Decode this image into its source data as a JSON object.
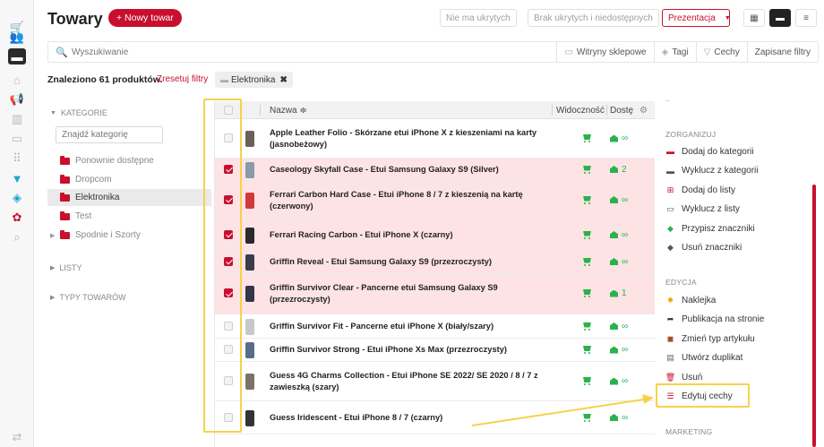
{
  "header": {
    "title": "Towary",
    "new_button": "+ Nowy towar",
    "filter_hidden": "Nie ma ukrytych",
    "filter_missing": "Brak ukrytych i niedostępnych",
    "presentation": "Prezentacja",
    "view_modes": [
      "grid-icon",
      "list-icon",
      "compact-list-icon"
    ]
  },
  "search": {
    "placeholder": "Wyszukiwanie",
    "filters": [
      {
        "label": "Witryny sklepowe",
        "icon": "storefront-icon"
      },
      {
        "label": "Tagi",
        "icon": "tag-icon"
      },
      {
        "label": "Cechy",
        "icon": "funnel-icon"
      },
      {
        "label": "Zapisane filtry",
        "icon": ""
      }
    ]
  },
  "results": {
    "found": "Znaleziono 61 produktów.",
    "reset": "Zresetuj filtry",
    "chip": "Elektronika"
  },
  "categories": {
    "header": "KATEGORIE",
    "search_placeholder": "Znajdź kategorię",
    "items": [
      {
        "label": "Ponownie dostępne",
        "selected": false,
        "expandable": false
      },
      {
        "label": "Dropcom",
        "selected": false,
        "expandable": false
      },
      {
        "label": "Elektronika",
        "selected": true,
        "expandable": false
      },
      {
        "label": "Test",
        "selected": false,
        "expandable": false
      },
      {
        "label": "Spodnie i Szorty",
        "selected": false,
        "expandable": true
      }
    ],
    "lists_header": "LISTY",
    "types_header": "TYPY TOWARÓW"
  },
  "table": {
    "col_name": "Nazwa ≑",
    "col_visibility": "Widoczność",
    "col_availability": "Dostę",
    "rows": [
      {
        "name": "Apple Leather Folio - Skórzane etui iPhone X z kieszeniami na karty (jasnobeżowy)",
        "checked": false,
        "stock": "∞",
        "thumb": "#6b6156"
      },
      {
        "name": "Caseology Skyfall Case - Etui Samsung Galaxy S9 (Silver)",
        "checked": true,
        "stock": "2",
        "thumb": "#8a9aa8"
      },
      {
        "name": "Ferrari Carbon Hard Case - Etui iPhone 8 / 7 z kieszenią na kartę (czerwony)",
        "checked": true,
        "stock": "∞",
        "thumb": "#d23a3a"
      },
      {
        "name": "Ferrari Racing Carbon - Etui iPhone X (czarny)",
        "checked": true,
        "stock": "∞",
        "thumb": "#2a2a2a"
      },
      {
        "name": "Griffin Reveal - Etui Samsung Galaxy S9 (przezroczysty)",
        "checked": true,
        "stock": "∞",
        "thumb": "#3b3b4a"
      },
      {
        "name": "Griffin Survivor Clear - Pancerne etui Samsung Galaxy S9 (przezroczysty)",
        "checked": true,
        "stock": "1",
        "thumb": "#34344a"
      },
      {
        "name": "Griffin Survivor Fit - Pancerne etui iPhone X (biały/szary)",
        "checked": false,
        "stock": "∞",
        "thumb": "#c8c8c8"
      },
      {
        "name": "Griffin Survivor Strong - Etui iPhone Xs Max (przezroczysty)",
        "checked": false,
        "stock": "∞",
        "thumb": "#5a6c8a"
      },
      {
        "name": "Guess 4G Charms Collection - Etui iPhone SE 2022/ SE 2020 / 8 / 7 z zawieszką (szary)",
        "checked": false,
        "stock": "∞",
        "thumb": "#7a7466"
      },
      {
        "name": "Guess Iridescent - Etui iPhone 8 / 7 (czarny)",
        "checked": false,
        "stock": "∞",
        "thumb": "#333"
      }
    ]
  },
  "actions": {
    "organize_header": "ZORGANIZUJ",
    "organize": [
      {
        "label": "Dodaj do kategorii",
        "icon": "folder-add-icon",
        "color": "#c8102e"
      },
      {
        "label": "Wyklucz z kategorii",
        "icon": "folder-remove-icon",
        "color": "#555"
      },
      {
        "label": "Dodaj do listy",
        "icon": "list-add-icon",
        "color": "#c8102e"
      },
      {
        "label": "Wyklucz z listy",
        "icon": "list-remove-icon",
        "color": "#555"
      },
      {
        "label": "Przypisz znaczniki",
        "icon": "tag-add-icon",
        "color": "#2bb24c"
      },
      {
        "label": "Usuń znaczniki",
        "icon": "tag-remove-icon",
        "color": "#555"
      }
    ],
    "edit_header": "EDYCJA",
    "edit": [
      {
        "label": "Naklejka",
        "icon": "sticker-icon",
        "color": "#f2a900"
      },
      {
        "label": "Publikacja na stronie",
        "icon": "share-icon",
        "color": "#333"
      },
      {
        "label": "Zmień typ artykułu",
        "icon": "box-icon",
        "color": "#a0522d"
      },
      {
        "label": "Utwórz duplikat",
        "icon": "duplicate-icon",
        "color": "#666"
      },
      {
        "label": "Usuń",
        "icon": "trash-icon",
        "color": "#c8102e"
      },
      {
        "label": "Edytuj cechy",
        "icon": "sliders-icon",
        "color": "#c8102e"
      }
    ],
    "marketing_header": "MARKETING"
  },
  "colors": {
    "accent": "#c8102e",
    "ok": "#2bb24c",
    "annotation": "#f6d24a",
    "checked_row": "#fde3e4"
  }
}
